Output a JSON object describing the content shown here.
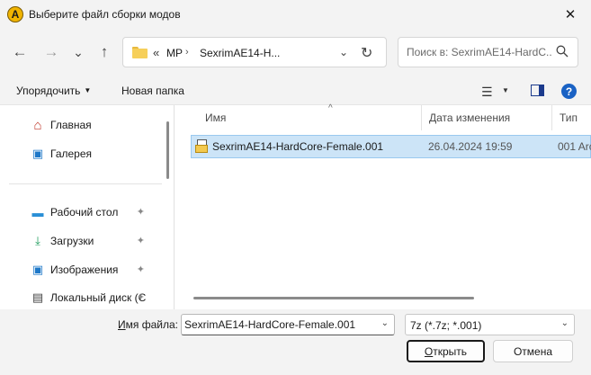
{
  "window": {
    "title": "Выберите файл сборки модов",
    "app_icon_letter": "A",
    "close_glyph": "✕"
  },
  "navigation": {
    "back_glyph": "←",
    "forward_glyph": "→",
    "recent_glyph": "⌄",
    "up_glyph": "↑",
    "breadcrumb_separator": "«",
    "breadcrumb": [
      "MP",
      "SexrimAE14-H..."
    ],
    "breadcrumb_arrow": "›",
    "address_dropdown_glyph": "⌄",
    "refresh_glyph": "↻",
    "search_placeholder": "Поиск в: SexrimAE14-HardC..."
  },
  "command_bar": {
    "organize_label": "Упорядочить",
    "organize_caret": "▼",
    "new_folder_label": "Новая папка",
    "view_glyph": "☰",
    "view_caret": "▼",
    "help_glyph": "?"
  },
  "sidebar": {
    "items": [
      {
        "label": "Главная",
        "icon": "home-icon",
        "glyph": "⌂",
        "pinned": false
      },
      {
        "label": "Галерея",
        "icon": "gallery-icon",
        "glyph": "▣",
        "pinned": false
      },
      {
        "label": "Рабочий стол",
        "icon": "desktop-icon",
        "glyph": "▬",
        "pinned": true
      },
      {
        "label": "Загрузки",
        "icon": "downloads-icon",
        "glyph": "⤓",
        "pinned": true
      },
      {
        "label": "Изображения",
        "icon": "pictures-icon",
        "glyph": "▣",
        "pinned": true
      },
      {
        "label": "Локальный диск (C",
        "icon": "drive-icon",
        "glyph": "▤",
        "pinned": true
      }
    ],
    "pin_glyph": "📌"
  },
  "file_list": {
    "columns": [
      "Имя",
      "Дата изменения",
      "Тип"
    ],
    "sort_glyph": "^",
    "rows": [
      {
        "name": "SexrimAE14-HardCore-Female.001",
        "modified": "26.04.2024 19:59",
        "type": "001 Arc"
      }
    ]
  },
  "footer": {
    "filename_label_underlined": "И",
    "filename_label_rest": "мя файла:",
    "filename_value": "SexrimAE14-HardCore-Female.001",
    "filetype_value": "7z (*.7z; *.001)",
    "dropdown_glyph": "⌄",
    "open_label_underlined": "О",
    "open_label_rest": "ткрыть",
    "cancel_label": "Отмена"
  },
  "colors": {
    "selection_bg": "#cce4f7",
    "selection_border": "#99c9ef",
    "accent": "#1a62c4"
  }
}
